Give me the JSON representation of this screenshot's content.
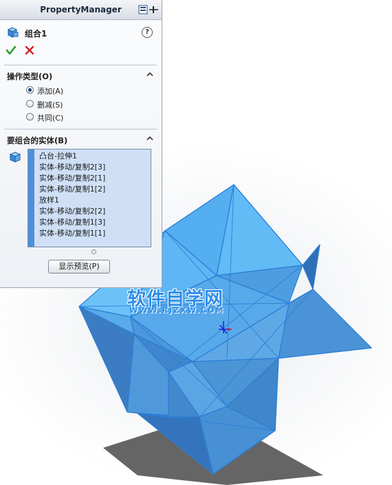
{
  "panel": {
    "title": "PropertyManager",
    "feature_name": "组合1",
    "help_glyph": "?"
  },
  "operation_type": {
    "title": "操作类型(O)",
    "options": [
      {
        "label": "添加(A)",
        "checked": true
      },
      {
        "label": "删减(S)",
        "checked": false
      },
      {
        "label": "共同(C)",
        "checked": false
      }
    ]
  },
  "bodies_group": {
    "title": "要组合的实体(B)",
    "items": [
      "凸台-拉伸1",
      "实体-移动/复制2[3]",
      "实体-移动/复制2[1]",
      "实体-移动/复制1[2]",
      "放样1",
      "实体-移动/复制2[2]",
      "实体-移动/复制1[3]",
      "实体-移动/复制1[1]"
    ]
  },
  "preview_button_label": "显示预览(P)",
  "watermark": {
    "main": "软件自学网",
    "url": "WWW.RJZXW.COM"
  },
  "icons": [
    "pin-icon",
    "combine-feature-icon",
    "help-icon",
    "ok-check-icon",
    "cancel-x-icon",
    "chevron-up-icon",
    "solid-body-icon",
    "origin-triad-icon"
  ],
  "colors": {
    "model_fill": "#5ab2f2",
    "model_edge": "#2c7fd6",
    "list_background": "#cfe0f6",
    "list_accent": "#4f8ed8",
    "ok_green": "#2e9a2e",
    "cancel_red": "#d42020",
    "watermark": "#2f8ee8"
  }
}
